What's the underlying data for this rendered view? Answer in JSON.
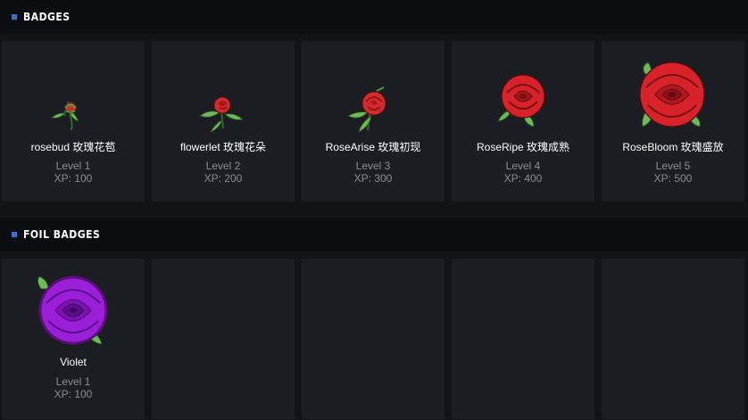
{
  "badges": {
    "title": "BADGES",
    "items": [
      {
        "name": "rosebud 玫瑰花苞",
        "level": "Level 1",
        "xp": "XP: 100",
        "icon": "rosebud-icon"
      },
      {
        "name": "flowerlet 玫瑰花朵",
        "level": "Level 2",
        "xp": "XP: 200",
        "icon": "small-rose-icon"
      },
      {
        "name": "RoseArise 玫瑰初现",
        "level": "Level 3",
        "xp": "XP: 300",
        "icon": "rose-arise-icon"
      },
      {
        "name": "RoseRipe 玫瑰成熟",
        "level": "Level 4",
        "xp": "XP: 400",
        "icon": "rose-ripe-icon"
      },
      {
        "name": "RoseBloom 玫瑰盛放",
        "level": "Level 5",
        "xp": "XP: 500",
        "icon": "rose-bloom-icon"
      }
    ]
  },
  "foil_badges": {
    "title": "FOIL BADGES",
    "items": [
      {
        "name": "Violet",
        "level": "Level 1",
        "xp": "XP: 100",
        "icon": "violet-rose-icon"
      }
    ]
  },
  "colors": {
    "background": "#121317",
    "card": "#1c1d22",
    "header": "#0c0d10",
    "accent": "#3b6ed6",
    "muted_text": "#8a8c93",
    "rose_red": "#d8222a",
    "violet": "#9b1fd8",
    "leaf_green": "#5fae4a"
  }
}
